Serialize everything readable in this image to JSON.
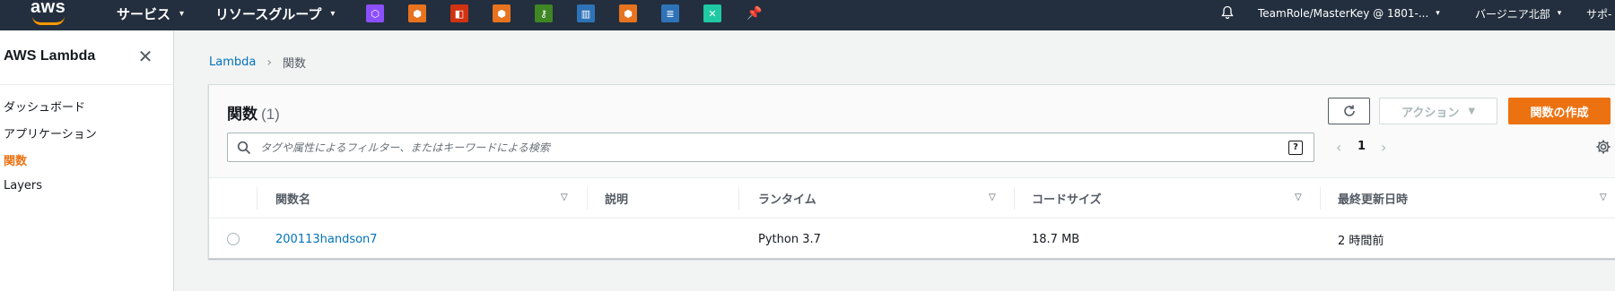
{
  "topnav": {
    "logo_text": "aws",
    "services_label": "サービス",
    "resource_groups_label": "リソースグループ",
    "pinned_icons": [
      {
        "name": "cognito-icon",
        "color": "#8c4fff"
      },
      {
        "name": "api-gateway-icon",
        "color": "#e7731e"
      },
      {
        "name": "codepipeline-icon",
        "color": "#d13212"
      },
      {
        "name": "ecr-icon",
        "color": "#e7731e"
      },
      {
        "name": "kms-key-icon",
        "color": "#3f8624"
      },
      {
        "name": "cloudfront-icon",
        "color": "#2e73b8"
      },
      {
        "name": "sagemaker-icon",
        "color": "#e7731e"
      },
      {
        "name": "dynamodb-icon",
        "color": "#2e73b8"
      },
      {
        "name": "step-functions-icon",
        "color": "#1ec9a3"
      }
    ],
    "account_label": "TeamRole/MasterKey @ 1801-...",
    "region_label": "バージニア北部",
    "support_label": "サポ-"
  },
  "sidebar": {
    "title": "AWS Lambda",
    "items": [
      {
        "label": "ダッシュボード",
        "active": false
      },
      {
        "label": "アプリケーション",
        "active": false
      },
      {
        "label": "関数",
        "active": true
      },
      {
        "label": "Layers",
        "active": false
      }
    ]
  },
  "breadcrumb": {
    "root": "Lambda",
    "current": "関数"
  },
  "functions": {
    "title": "関数",
    "count": "(1)",
    "action_label": "アクション",
    "create_label": "関数の作成",
    "search_placeholder": "タグや属性によるフィルター、またはキーワードによる検索",
    "page": "1",
    "columns": [
      "関数名",
      "説明",
      "ランタイム",
      "コードサイズ",
      "最終更新日時"
    ],
    "rows": [
      {
        "name": "200113handson7",
        "description": "",
        "runtime": "Python 3.7",
        "code_size": "18.7 MB",
        "last_modified": "2 時間前"
      }
    ]
  },
  "colors": {
    "nav_bg": "#232f3e",
    "accent": "#ec7211",
    "link": "#0073bb"
  }
}
